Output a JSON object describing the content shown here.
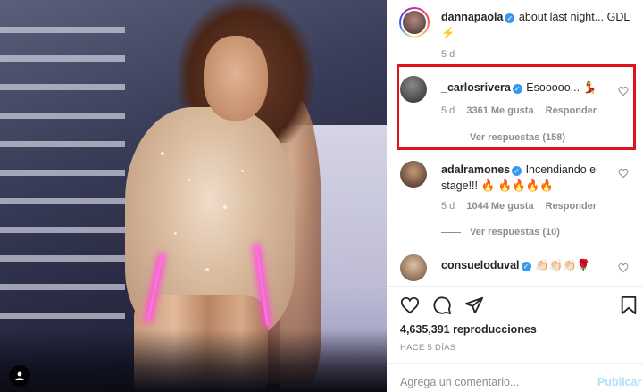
{
  "post": {
    "author": "dannapaola",
    "caption": "about last night... GDL ⚡",
    "age": "5 d"
  },
  "comments": [
    {
      "user": "_carlosrivera",
      "text": "Esooooo... 💃",
      "age": "5 d",
      "likes": "3361 Me gusta",
      "reply_label": "Responder",
      "view_replies": "Ver respuestas (158)"
    },
    {
      "user": "adalramones",
      "text": "Incendiando el stage!!! 🔥 🔥🔥🔥🔥",
      "age": "5 d",
      "likes": "1044 Me gusta",
      "reply_label": "Responder",
      "view_replies": "Ver respuestas (10)"
    },
    {
      "user": "consueloduval",
      "text": "👏🏻👏🏻👏🏻🌹"
    }
  ],
  "stats": {
    "views": "4,635,391 reproducciones",
    "posted_ago": "HACE 5 DÍAS"
  },
  "composer": {
    "placeholder": "Agrega un comentario...",
    "publish_label": "Publicar"
  },
  "colors": {
    "verified": "#3897f0",
    "highlight_box": "#e0121b",
    "publish_disabled": "#b2dffc"
  }
}
